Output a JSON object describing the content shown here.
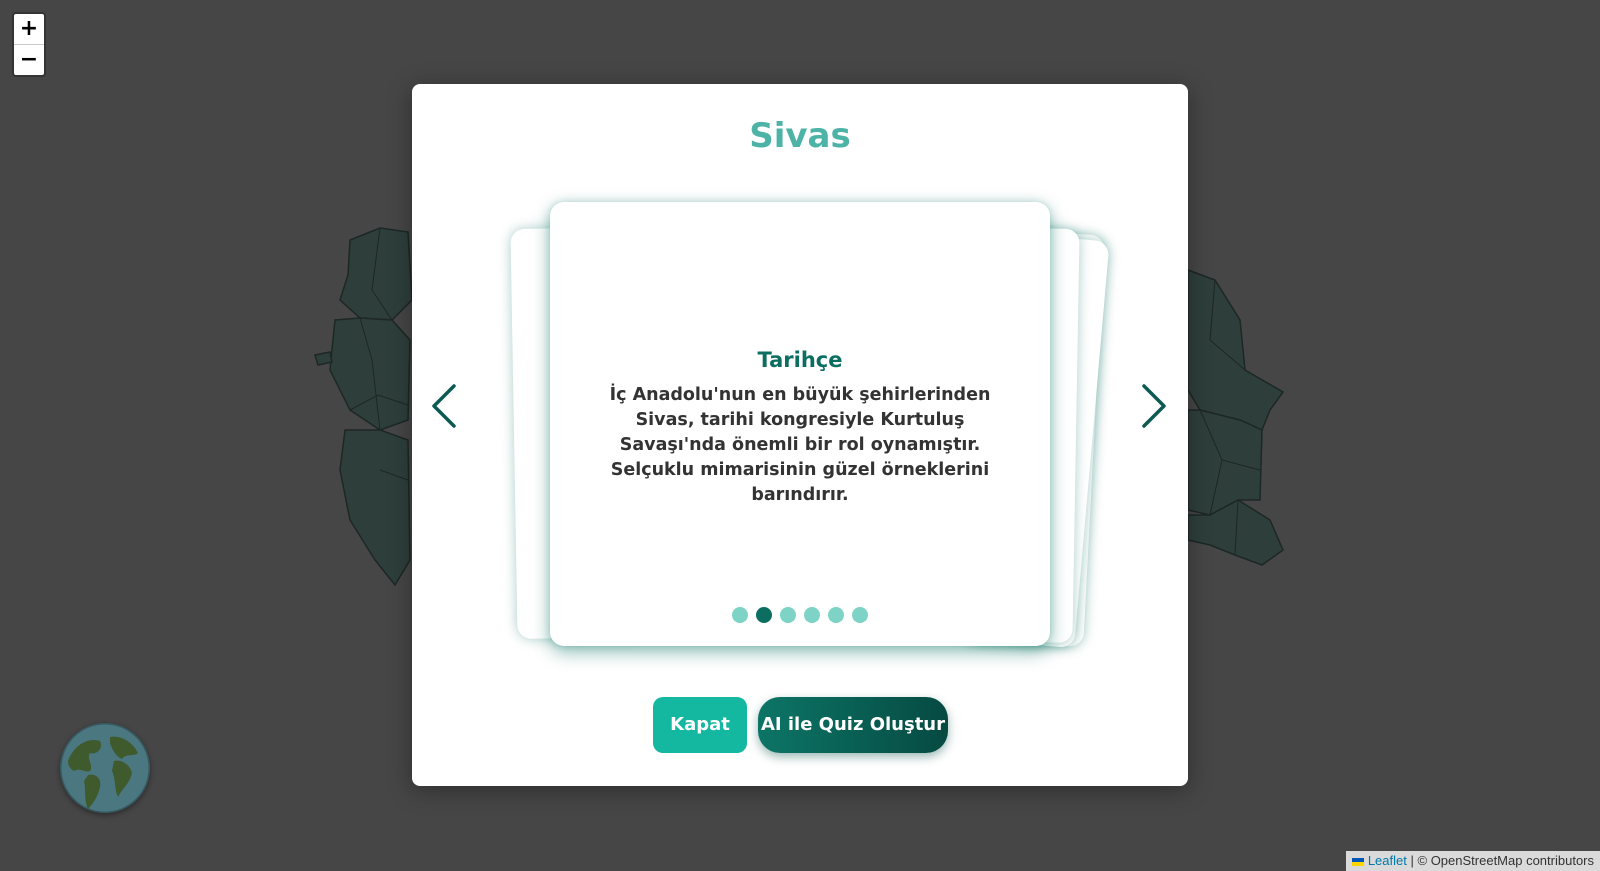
{
  "map": {
    "zoom_in_label": "+",
    "zoom_out_label": "−",
    "province_fill": "#2e3f3b",
    "province_stroke": "#1d2725",
    "background": "#464646"
  },
  "attribution": {
    "leaflet_link": "Leaflet",
    "separator": "|",
    "osm_text": "© OpenStreetMap contributors"
  },
  "modal": {
    "title": "Sivas",
    "card": {
      "heading": "Tarihçe",
      "body": "İç Anadolu'nun en büyük şehirlerinden Sivas, tarihi kongresiyle Kurtuluş Savaşı'nda önemli bir rol oynamıştır. Selçuklu mimarisinin güzel örneklerini barındırır."
    },
    "pagination": {
      "total": 6,
      "active_index": 1
    },
    "buttons": {
      "close_label": "Kapat",
      "quiz_label": "AI ile Quiz Oluştur"
    },
    "colors": {
      "title": "#4db3a7",
      "accent_dark": "#0c6e61",
      "accent_light": "#14b8a0",
      "dot_inactive": "#7dd3c6"
    },
    "icons": {
      "prev": "chevron-left-icon",
      "next": "chevron-right-icon"
    }
  }
}
